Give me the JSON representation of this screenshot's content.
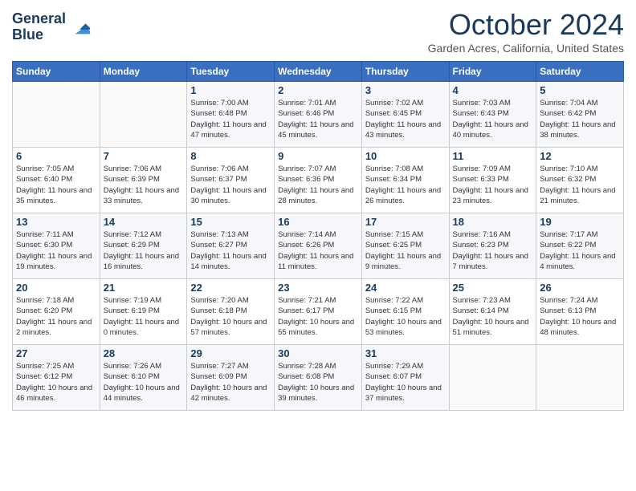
{
  "header": {
    "logo_line1": "General",
    "logo_line2": "Blue",
    "month_title": "October 2024",
    "location": "Garden Acres, California, United States"
  },
  "weekdays": [
    "Sunday",
    "Monday",
    "Tuesday",
    "Wednesday",
    "Thursday",
    "Friday",
    "Saturday"
  ],
  "weeks": [
    [
      {
        "num": "",
        "info": ""
      },
      {
        "num": "",
        "info": ""
      },
      {
        "num": "1",
        "info": "Sunrise: 7:00 AM\nSunset: 6:48 PM\nDaylight: 11 hours and 47 minutes."
      },
      {
        "num": "2",
        "info": "Sunrise: 7:01 AM\nSunset: 6:46 PM\nDaylight: 11 hours and 45 minutes."
      },
      {
        "num": "3",
        "info": "Sunrise: 7:02 AM\nSunset: 6:45 PM\nDaylight: 11 hours and 43 minutes."
      },
      {
        "num": "4",
        "info": "Sunrise: 7:03 AM\nSunset: 6:43 PM\nDaylight: 11 hours and 40 minutes."
      },
      {
        "num": "5",
        "info": "Sunrise: 7:04 AM\nSunset: 6:42 PM\nDaylight: 11 hours and 38 minutes."
      }
    ],
    [
      {
        "num": "6",
        "info": "Sunrise: 7:05 AM\nSunset: 6:40 PM\nDaylight: 11 hours and 35 minutes."
      },
      {
        "num": "7",
        "info": "Sunrise: 7:06 AM\nSunset: 6:39 PM\nDaylight: 11 hours and 33 minutes."
      },
      {
        "num": "8",
        "info": "Sunrise: 7:06 AM\nSunset: 6:37 PM\nDaylight: 11 hours and 30 minutes."
      },
      {
        "num": "9",
        "info": "Sunrise: 7:07 AM\nSunset: 6:36 PM\nDaylight: 11 hours and 28 minutes."
      },
      {
        "num": "10",
        "info": "Sunrise: 7:08 AM\nSunset: 6:34 PM\nDaylight: 11 hours and 26 minutes."
      },
      {
        "num": "11",
        "info": "Sunrise: 7:09 AM\nSunset: 6:33 PM\nDaylight: 11 hours and 23 minutes."
      },
      {
        "num": "12",
        "info": "Sunrise: 7:10 AM\nSunset: 6:32 PM\nDaylight: 11 hours and 21 minutes."
      }
    ],
    [
      {
        "num": "13",
        "info": "Sunrise: 7:11 AM\nSunset: 6:30 PM\nDaylight: 11 hours and 19 minutes."
      },
      {
        "num": "14",
        "info": "Sunrise: 7:12 AM\nSunset: 6:29 PM\nDaylight: 11 hours and 16 minutes."
      },
      {
        "num": "15",
        "info": "Sunrise: 7:13 AM\nSunset: 6:27 PM\nDaylight: 11 hours and 14 minutes."
      },
      {
        "num": "16",
        "info": "Sunrise: 7:14 AM\nSunset: 6:26 PM\nDaylight: 11 hours and 11 minutes."
      },
      {
        "num": "17",
        "info": "Sunrise: 7:15 AM\nSunset: 6:25 PM\nDaylight: 11 hours and 9 minutes."
      },
      {
        "num": "18",
        "info": "Sunrise: 7:16 AM\nSunset: 6:23 PM\nDaylight: 11 hours and 7 minutes."
      },
      {
        "num": "19",
        "info": "Sunrise: 7:17 AM\nSunset: 6:22 PM\nDaylight: 11 hours and 4 minutes."
      }
    ],
    [
      {
        "num": "20",
        "info": "Sunrise: 7:18 AM\nSunset: 6:20 PM\nDaylight: 11 hours and 2 minutes."
      },
      {
        "num": "21",
        "info": "Sunrise: 7:19 AM\nSunset: 6:19 PM\nDaylight: 11 hours and 0 minutes."
      },
      {
        "num": "22",
        "info": "Sunrise: 7:20 AM\nSunset: 6:18 PM\nDaylight: 10 hours and 57 minutes."
      },
      {
        "num": "23",
        "info": "Sunrise: 7:21 AM\nSunset: 6:17 PM\nDaylight: 10 hours and 55 minutes."
      },
      {
        "num": "24",
        "info": "Sunrise: 7:22 AM\nSunset: 6:15 PM\nDaylight: 10 hours and 53 minutes."
      },
      {
        "num": "25",
        "info": "Sunrise: 7:23 AM\nSunset: 6:14 PM\nDaylight: 10 hours and 51 minutes."
      },
      {
        "num": "26",
        "info": "Sunrise: 7:24 AM\nSunset: 6:13 PM\nDaylight: 10 hours and 48 minutes."
      }
    ],
    [
      {
        "num": "27",
        "info": "Sunrise: 7:25 AM\nSunset: 6:12 PM\nDaylight: 10 hours and 46 minutes."
      },
      {
        "num": "28",
        "info": "Sunrise: 7:26 AM\nSunset: 6:10 PM\nDaylight: 10 hours and 44 minutes."
      },
      {
        "num": "29",
        "info": "Sunrise: 7:27 AM\nSunset: 6:09 PM\nDaylight: 10 hours and 42 minutes."
      },
      {
        "num": "30",
        "info": "Sunrise: 7:28 AM\nSunset: 6:08 PM\nDaylight: 10 hours and 39 minutes."
      },
      {
        "num": "31",
        "info": "Sunrise: 7:29 AM\nSunset: 6:07 PM\nDaylight: 10 hours and 37 minutes."
      },
      {
        "num": "",
        "info": ""
      },
      {
        "num": "",
        "info": ""
      }
    ]
  ],
  "colors": {
    "header_bg": "#3a6fbf",
    "title_color": "#1a3a5c"
  }
}
